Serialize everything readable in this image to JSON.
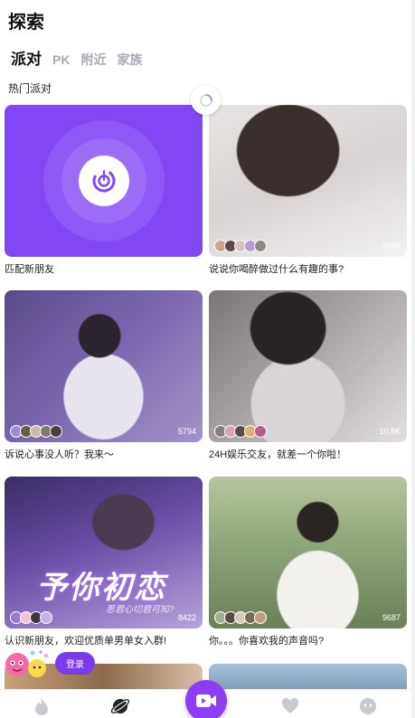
{
  "header": {
    "title": "探索"
  },
  "tabs": [
    {
      "label": "派对",
      "active": true
    },
    {
      "label": "PK",
      "active": false
    },
    {
      "label": "附近",
      "active": false
    },
    {
      "label": "家族",
      "active": false
    }
  ],
  "section": {
    "title": "热门派对"
  },
  "cards": [
    {
      "caption": "匹配新朋友",
      "count": ""
    },
    {
      "caption": "说说你喝醉做过什么有趣的事?",
      "count": "8640"
    },
    {
      "caption": "诉说心事没人听？我来～",
      "count": "5794"
    },
    {
      "caption": "24H娱乐交友，就差一个你啦！",
      "count": "10.8K"
    },
    {
      "caption": "认识新朋友，欢迎优质单男单女入群!",
      "count": "8422",
      "promo_title": "予你初恋",
      "promo_subtitle": "思君心切君可知?"
    },
    {
      "caption": "你。。。你喜欢我的声音吗?",
      "count": "9687"
    }
  ],
  "login": {
    "label": "登录"
  },
  "nav": {
    "items": [
      "flame-icon",
      "planet-icon",
      "video-icon",
      "heart-icon",
      "face-icon"
    ]
  },
  "colors": {
    "accent": "#8b3ff2",
    "match_bg": "#8247f5"
  }
}
